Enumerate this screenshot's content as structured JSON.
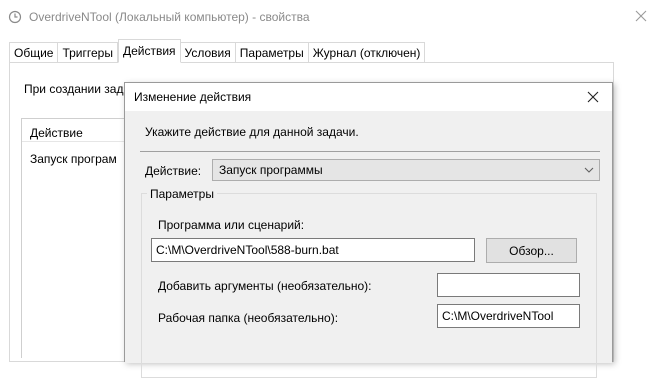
{
  "parent": {
    "title": "OverdriveNTool (Локальный компьютер) - свойства",
    "tabs": [
      "Общие",
      "Триггеры",
      "Действия",
      "Условия",
      "Параметры",
      "Журнал (отключен)"
    ],
    "active_tab_index": 2,
    "intro_text": "При создании зад",
    "table_header": "Действие",
    "table_row": "Запуск програм"
  },
  "dialog": {
    "title": "Изменение действия",
    "instruction": "Укажите действие для данной задачи.",
    "action_label": "Действие:",
    "action_value": "Запуск программы",
    "group_title": "Параметры",
    "program_label": "Программа или сценарий:",
    "program_value": "C:\\M\\OverdriveNTool\\588-burn.bat",
    "browse_label": "Обзор...",
    "args_label": "Добавить аргументы (необязательно):",
    "args_value": "",
    "workdir_label": "Рабочая папка (необязательно):",
    "workdir_value": "C:\\M\\OverdriveNTool"
  },
  "icons": {
    "app": "clock-icon",
    "close": "close-icon",
    "dropdown": "chevron-down-icon"
  }
}
